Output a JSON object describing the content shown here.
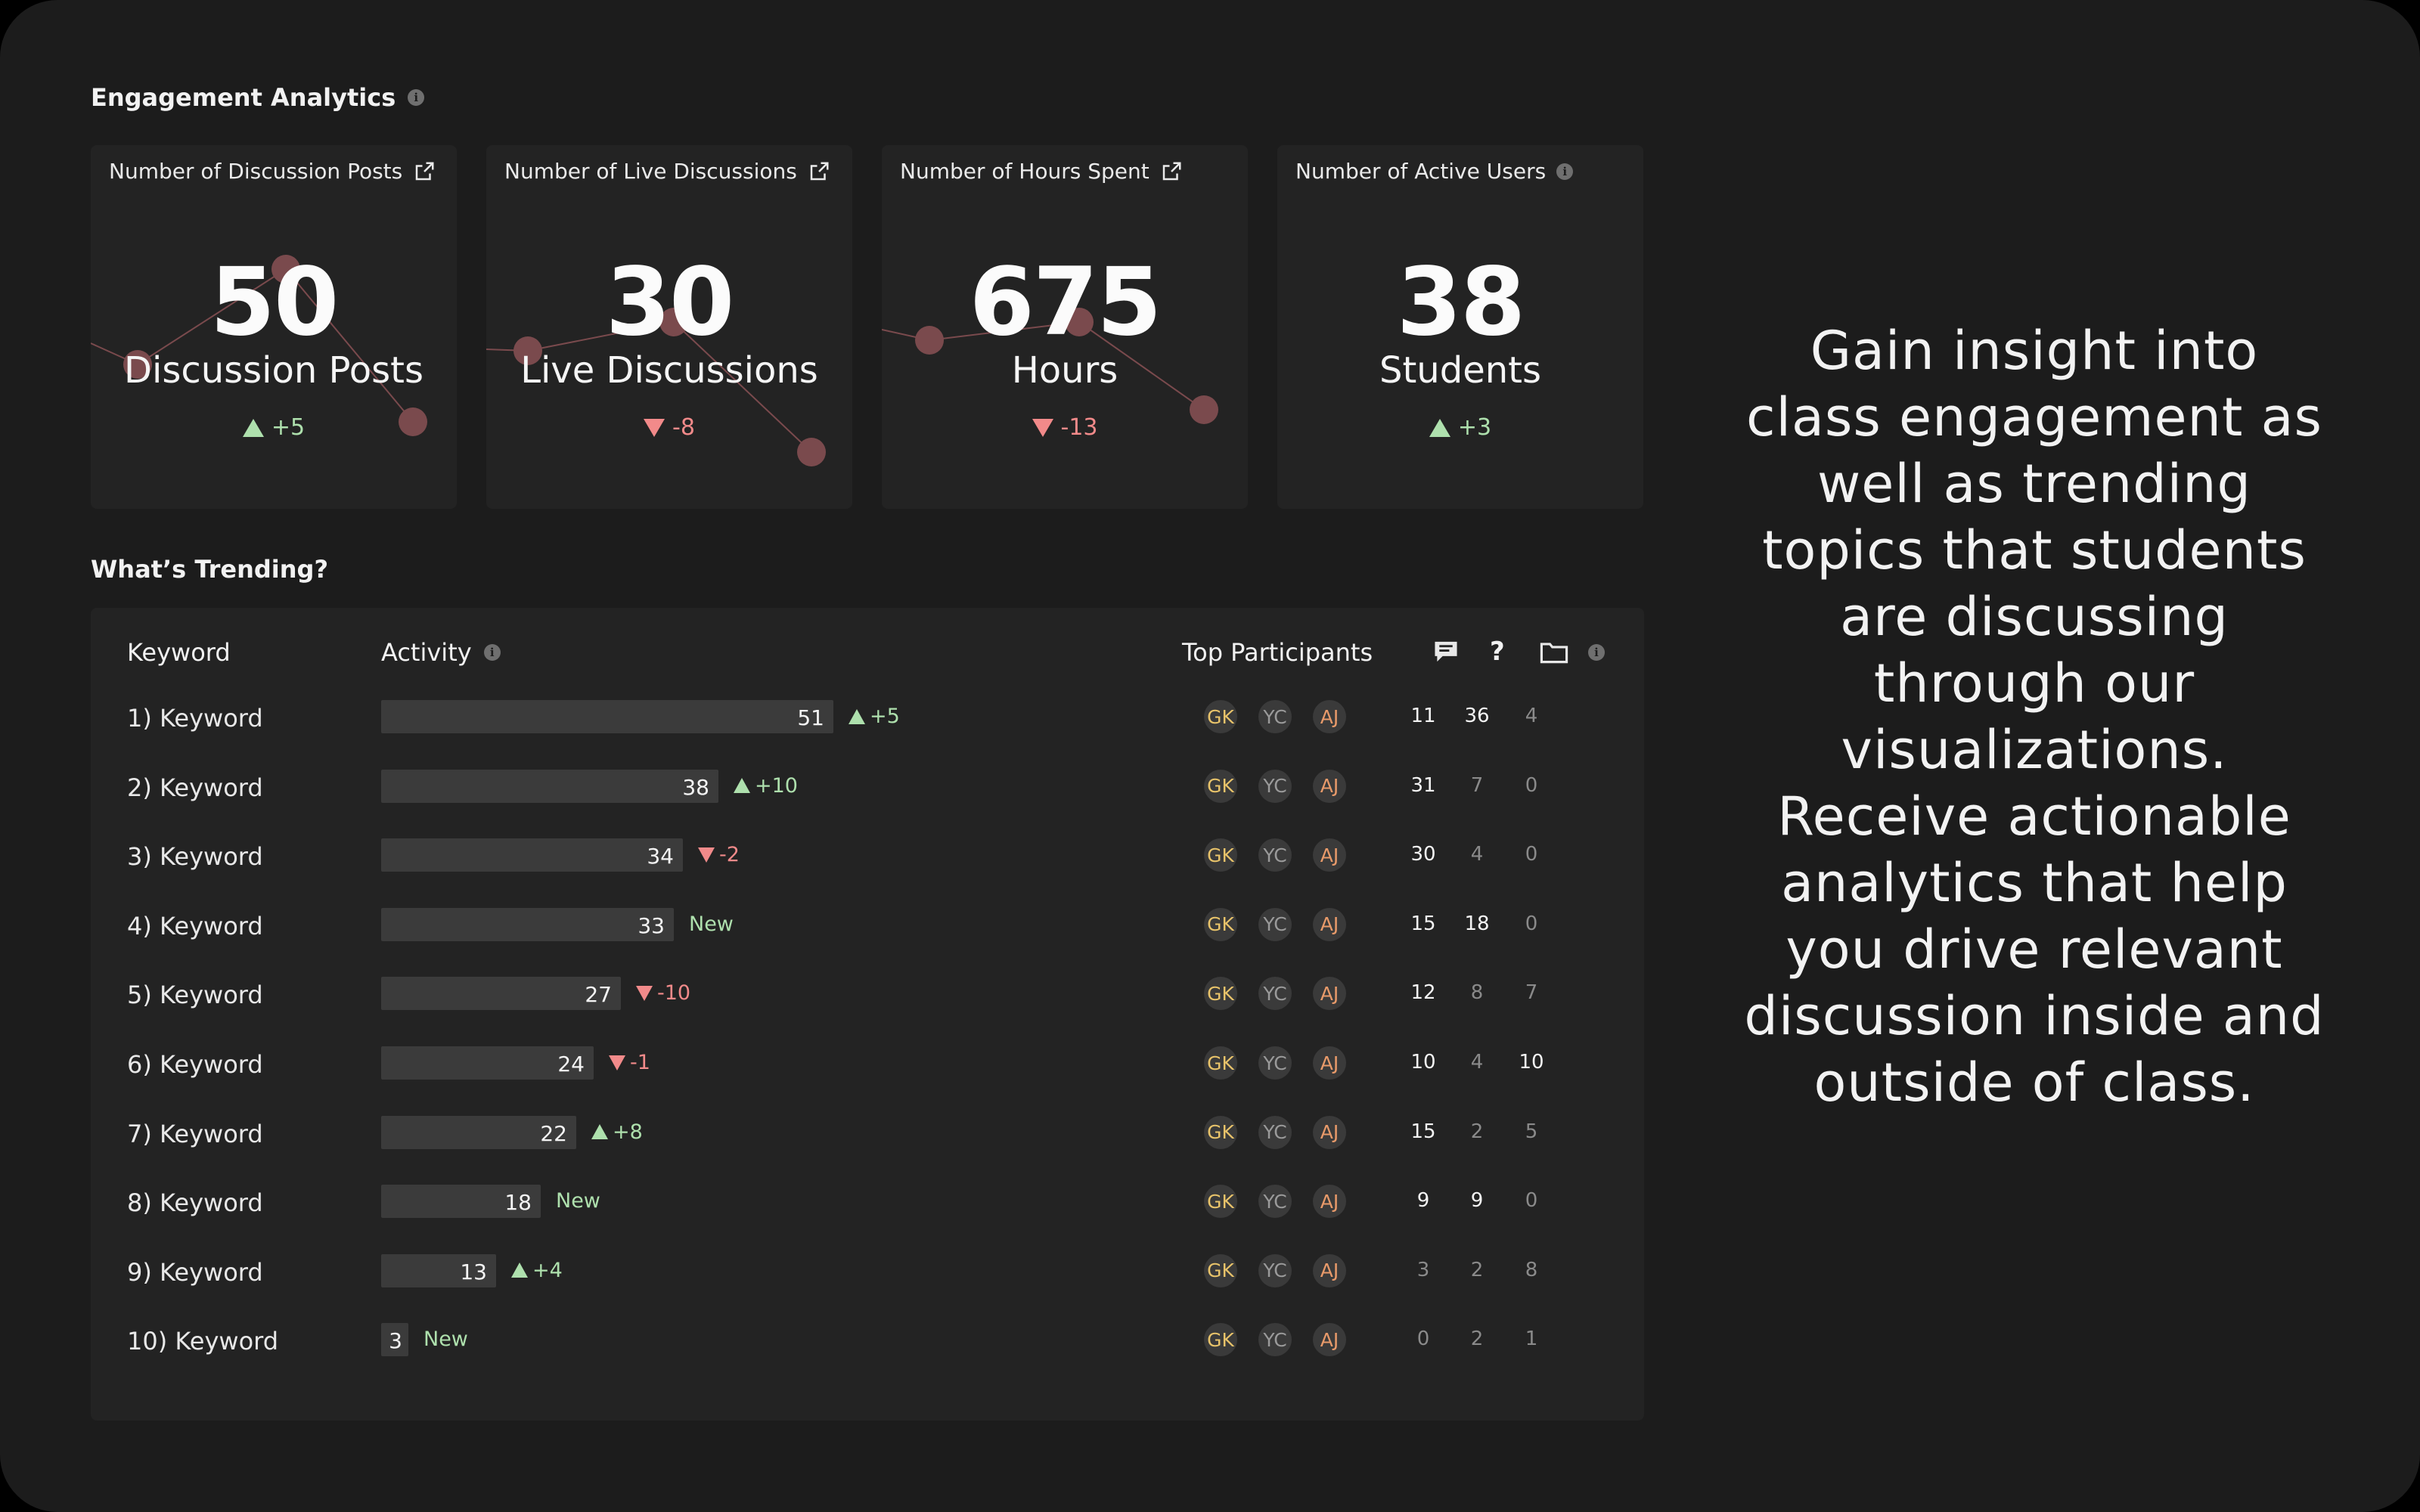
{
  "engagement": {
    "title": "Engagement Analytics",
    "cards": [
      {
        "title": "Number of Discussion Posts",
        "icon": "external-link-icon",
        "value": "50",
        "unit": "Discussion Posts",
        "delta": "+5",
        "trend": "up"
      },
      {
        "title": "Number of Live Discussions",
        "icon": "external-link-icon",
        "value": "30",
        "unit": "Live Discussions",
        "delta": "-8",
        "trend": "down"
      },
      {
        "title": "Number of Hours Spent",
        "icon": "external-link-icon",
        "value": "675",
        "unit": "Hours",
        "delta": "-13",
        "trend": "down"
      },
      {
        "title": "Number of Active Users",
        "icon": "info-icon",
        "value": "38",
        "unit": "Students",
        "delta": "+3",
        "trend": "up"
      }
    ]
  },
  "trending": {
    "title": "What’s Trending?",
    "headers": {
      "keyword": "Keyword",
      "activity": "Activity",
      "participants": "Top Participants",
      "posts_icon": "comment-icon",
      "questions_icon": "question-icon",
      "files_icon": "folder-icon"
    },
    "question_mark": "?",
    "rows": [
      {
        "keyword": "1) Keyword",
        "activity": 51,
        "change": "+5",
        "dir": "up",
        "participants": [
          "GK",
          "YC",
          "AJ"
        ],
        "posts": "11",
        "questions": "36",
        "files": "4"
      },
      {
        "keyword": "2) Keyword",
        "activity": 38,
        "change": "+10",
        "dir": "up",
        "participants": [
          "GK",
          "YC",
          "AJ"
        ],
        "posts": "31",
        "questions": "7",
        "files": "0"
      },
      {
        "keyword": "3) Keyword",
        "activity": 34,
        "change": "-2",
        "dir": "down",
        "participants": [
          "GK",
          "YC",
          "AJ"
        ],
        "posts": "30",
        "questions": "4",
        "files": "0"
      },
      {
        "keyword": "4) Keyword",
        "activity": 33,
        "change": "New",
        "dir": "new",
        "participants": [
          "GK",
          "YC",
          "AJ"
        ],
        "posts": "15",
        "questions": "18",
        "files": "0"
      },
      {
        "keyword": "5) Keyword",
        "activity": 27,
        "change": "-10",
        "dir": "down",
        "participants": [
          "GK",
          "YC",
          "AJ"
        ],
        "posts": "12",
        "questions": "8",
        "files": "7"
      },
      {
        "keyword": "6) Keyword",
        "activity": 24,
        "change": "-1",
        "dir": "down",
        "participants": [
          "GK",
          "YC",
          "AJ"
        ],
        "posts": "10",
        "questions": "4",
        "files": "10"
      },
      {
        "keyword": "7) Keyword",
        "activity": 22,
        "change": "+8",
        "dir": "up",
        "participants": [
          "GK",
          "YC",
          "AJ"
        ],
        "posts": "15",
        "questions": "2",
        "files": "5"
      },
      {
        "keyword": "8) Keyword",
        "activity": 18,
        "change": "New",
        "dir": "new",
        "participants": [
          "GK",
          "YC",
          "AJ"
        ],
        "posts": "9",
        "questions": "9",
        "files": "0"
      },
      {
        "keyword": "9) Keyword",
        "activity": 13,
        "change": "+4",
        "dir": "up",
        "participants": [
          "GK",
          "YC",
          "AJ"
        ],
        "posts": "3",
        "questions": "2",
        "files": "8"
      },
      {
        "keyword": "10) Keyword",
        "activity": 3,
        "change": "New",
        "dir": "new",
        "participants": [
          "GK",
          "YC",
          "AJ"
        ],
        "posts": "0",
        "questions": "2",
        "files": "1"
      }
    ]
  },
  "side_text": "Gain insight into class engagement as well as trending topics that students are discussing through our visualizations. Receive actionable analytics that help you drive relevant discussion inside and outside of class.",
  "colors": {
    "background": "#1c1c1c",
    "card": "#232323",
    "up": "#aee0ad",
    "down": "#f28a8a",
    "sparkline": "#7a4a4d"
  }
}
